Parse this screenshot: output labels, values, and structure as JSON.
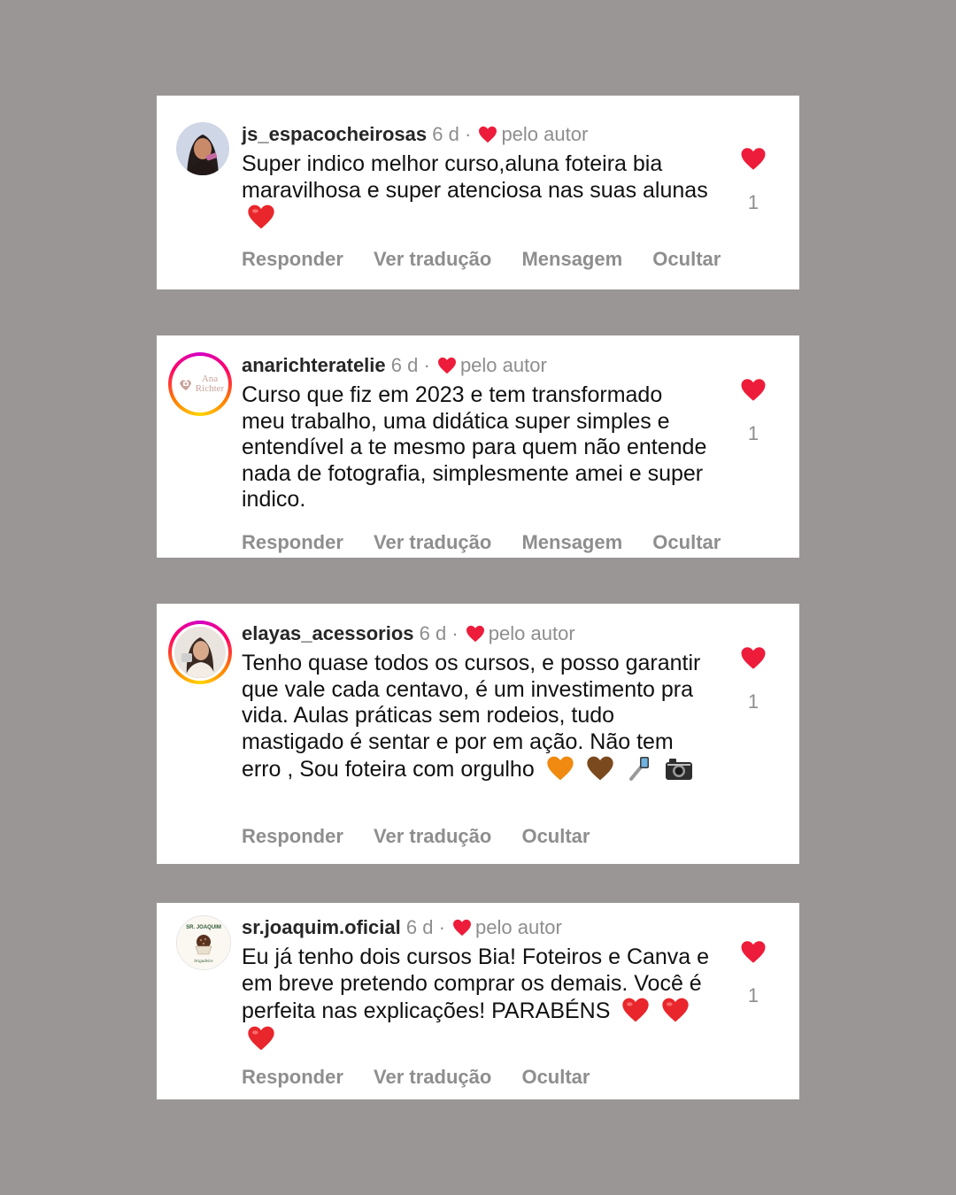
{
  "colors": {
    "background": "#9a9696",
    "heart": "#ed1c3a",
    "muted": "#8e8e8e"
  },
  "comments": [
    {
      "username": "js_espacocheirosas",
      "time": "6 d",
      "dot": "·",
      "by_author": "pelo autor",
      "text": "Super indico melhor curso,aluna foteira bia maravilhosa e super atenciosa nas suas alunas",
      "emojis": [
        "red-heart"
      ],
      "actions": [
        "Responder",
        "Ver tradução",
        "Mensagem",
        "Ocultar"
      ],
      "likes": "1",
      "avatar": "photo-woman-avatar"
    },
    {
      "username": "anarichteratelie",
      "time": "6 d",
      "dot": "·",
      "by_author": "pelo autor",
      "text": "Curso que fiz em 2023 e tem transformado meu trabalho, uma didática super simples e entendível a te mesmo para quem não entende nada de fotografia, simplesmente amei e super indico.",
      "emojis": [],
      "actions": [
        "Responder",
        "Ver tradução",
        "Mensagem",
        "Ocultar"
      ],
      "likes": "1",
      "avatar": "logo-avatar",
      "avatar_logo_text": [
        "Ana",
        "Richter"
      ]
    },
    {
      "username": "elayas_acessorios",
      "time": "6 d",
      "dot": "·",
      "by_author": "pelo autor",
      "text": "Tenho quase todos os cursos, e posso garantir que vale cada centavo, é um investimento pra vida. Aulas práticas sem rodeios, tudo mastigado é sentar e por em ação.  Não tem erro , Sou foteira com orgulho",
      "emojis": [
        "orange-heart",
        "brown-heart",
        "selfie-stick",
        "camera"
      ],
      "actions": [
        "Responder",
        "Ver tradução",
        "Ocultar"
      ],
      "likes": "1",
      "avatar": "photo-woman-avatar"
    },
    {
      "username": "sr.joaquim.oficial",
      "time": "6 d",
      "dot": "·",
      "by_author": "pelo autor",
      "text": "Eu já tenho dois cursos Bia! Foteiros e Canva e em breve pretendo comprar os demais. Você é perfeita nas explicações! PARABÉNS",
      "emojis": [
        "red-heart",
        "red-heart",
        "red-heart"
      ],
      "actions": [
        "Responder",
        "Ver tradução",
        "Ocultar"
      ],
      "likes": "1",
      "avatar": "brigadeiro-logo-avatar",
      "avatar_logo_text": [
        "SR. JOAQUIM",
        "brigadeiro"
      ]
    }
  ]
}
